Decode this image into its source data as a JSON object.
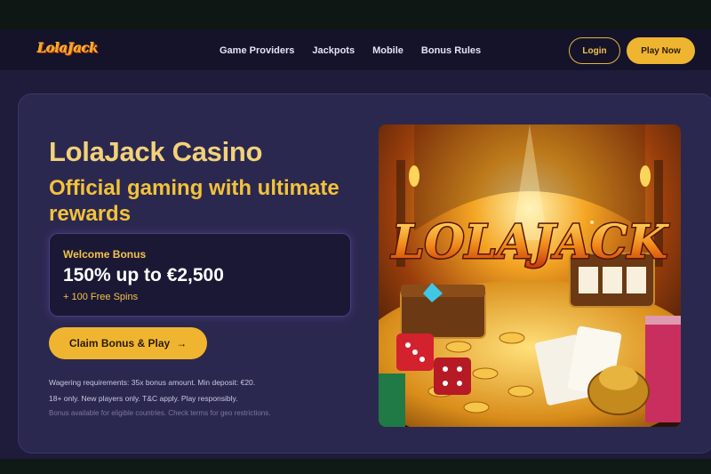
{
  "header": {
    "logo_text": "LolaJack",
    "nav": [
      "Game Providers",
      "Jackpots",
      "Mobile",
      "Bonus Rules"
    ],
    "login_label": "Login",
    "play_label": "Play Now"
  },
  "hero": {
    "title": "LolaJack Casino",
    "subtitle": "Official gaming with ultimate rewards",
    "bonus": {
      "label": "Welcome Bonus",
      "amount": "150% up to €2,500",
      "extra": "+ 100 Free Spins"
    },
    "cta_label": "Claim Bonus & Play",
    "cta_icon": "arrow-right-icon",
    "fine_print": [
      "Wagering requirements: 35x bonus amount. Min deposit: €20.",
      "18+ only. New players only. T&C apply. Play responsibly.",
      "Bonus available for eligible countries. Check terms for geo restrictions."
    ],
    "art_logo": "LOLAJACK"
  },
  "colors": {
    "accent": "#f0b530",
    "page_bg": "#1e1b3b",
    "card_bg": "#2b2850",
    "header_bg": "#14132a"
  }
}
